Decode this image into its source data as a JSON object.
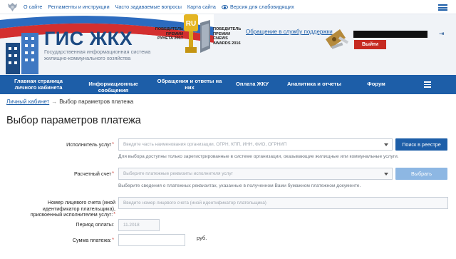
{
  "topbar": {
    "links": [
      "О сайте",
      "Регламенты и инструкции",
      "Часто задаваемые вопросы",
      "Карта сайта"
    ],
    "accessibility_label": "Версия для слабовидящих"
  },
  "header": {
    "logo_title": "ГИС ЖКХ",
    "logo_subtitle": "Государственная информационная система жилищно-коммунального хозяйства",
    "award1": "ПОБЕДИТЕЛЬ ПРЕМИИ РУНЕТА 2017",
    "award2": "ПОБЕДИТЕЛЬ ПРЕМИИ CNEWS AWARDS 2016",
    "support_link": "Обращение в службу поддержки",
    "login_button": "Выйти"
  },
  "nav": {
    "items": [
      "Главная страница личного кабинета",
      "Информационные сообщения",
      "Обращения и ответы на них",
      "Оплата ЖКУ",
      "Аналитика и отчеты",
      "Форум"
    ]
  },
  "breadcrumb": {
    "link": "Личный кабинет",
    "current": "Выбор параметров платежа"
  },
  "page_title": "Выбор параметров платежа",
  "form": {
    "provider_label": "Исполнитель услуг",
    "provider_placeholder": "Введите часть наименования организации, ОГРН, КПП, ИНН, ФИО, ОГРНИП",
    "provider_hint": "Для выбора доступны только зарегистрированные в системе организации, оказывающие жилищные или коммунальные услуги.",
    "registry_button": "Поиск в реестре",
    "account_label": "Расчетный счет",
    "account_placeholder": "Выберите платежные реквизиты исполнителя услуг",
    "account_hint": "Выберите сведения о платежных реквизитах, указанные в полученном Вами бумажном платежном документе.",
    "choose_button": "Выбрать",
    "personal_account_label": "Номер лицевого счета (иной идентификатор плательщика), присвоенный исполнителем услуг:",
    "personal_account_placeholder": "Введите номер лицевого счета (иной идентификатор плательщика)",
    "period_label": "Период оплаты:",
    "period_value": "11.2018",
    "amount_label": "Сумма платежа:",
    "amount_value": "",
    "currency": "руб."
  },
  "colors": {
    "primary": "#1d5ea8",
    "danger": "#c62a21",
    "brand_dark": "#1c4a82"
  }
}
